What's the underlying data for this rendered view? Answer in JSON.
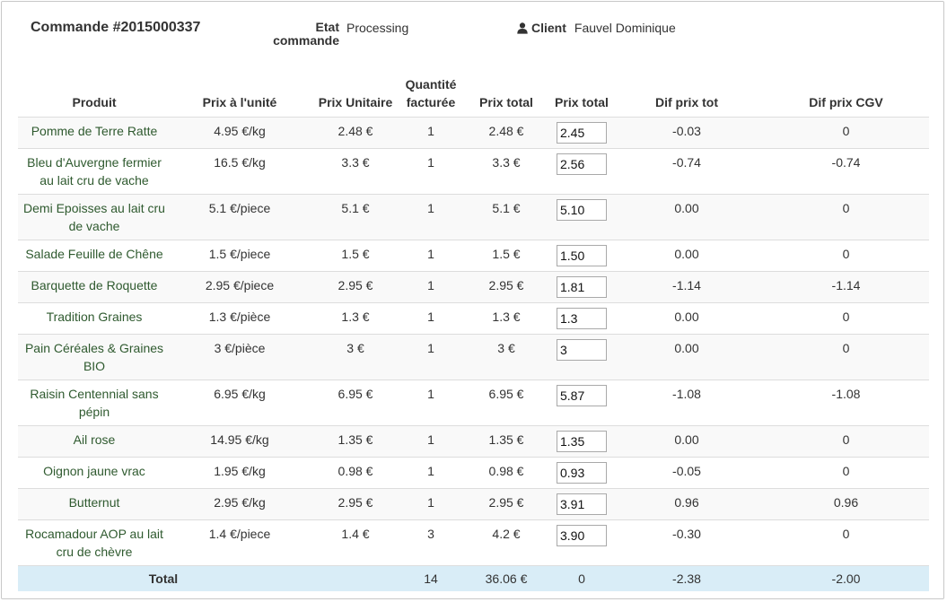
{
  "header": {
    "order_title": "Commande #2015000337",
    "status_label": "Etat commande",
    "status_value": "Processing",
    "client_label": "Client",
    "client_value": "Fauvel Dominique",
    "client_icon": "user-icon"
  },
  "table": {
    "columns": [
      "Produit",
      "Prix à l'unité",
      "Prix Unitaire",
      "Quantité facturée",
      "Prix total",
      "Prix total",
      "Dif prix tot",
      "Dif prix CGV"
    ],
    "rows": [
      {
        "product": "Pomme de Terre Ratte",
        "unit_price": "4.95 €/kg",
        "prix_unitaire": "2.48 €",
        "quantity": "1",
        "prix_total": "2.48 €",
        "input_value": "2.45",
        "dif_tot": "-0.03",
        "dif_cgv": "0"
      },
      {
        "product": "Bleu d'Auvergne fermier au lait cru de vache",
        "unit_price": "16.5 €/kg",
        "prix_unitaire": "3.3 €",
        "quantity": "1",
        "prix_total": "3.3 €",
        "input_value": "2.56",
        "dif_tot": "-0.74",
        "dif_cgv": "-0.74"
      },
      {
        "product": "Demi Epoisses au lait cru de vache",
        "unit_price": "5.1 €/piece",
        "prix_unitaire": "5.1 €",
        "quantity": "1",
        "prix_total": "5.1 €",
        "input_value": "5.10",
        "dif_tot": "0.00",
        "dif_cgv": "0"
      },
      {
        "product": "Salade Feuille de Chêne",
        "unit_price": "1.5 €/piece",
        "prix_unitaire": "1.5 €",
        "quantity": "1",
        "prix_total": "1.5 €",
        "input_value": "1.50",
        "dif_tot": "0.00",
        "dif_cgv": "0"
      },
      {
        "product": "Barquette de Roquette",
        "unit_price": "2.95 €/piece",
        "prix_unitaire": "2.95 €",
        "quantity": "1",
        "prix_total": "2.95 €",
        "input_value": "1.81",
        "dif_tot": "-1.14",
        "dif_cgv": "-1.14"
      },
      {
        "product": "Tradition Graines",
        "unit_price": "1.3 €/pièce",
        "prix_unitaire": "1.3 €",
        "quantity": "1",
        "prix_total": "1.3 €",
        "input_value": "1.3",
        "dif_tot": "0.00",
        "dif_cgv": "0"
      },
      {
        "product": "Pain Céréales & Graines BIO",
        "unit_price": "3 €/pièce",
        "prix_unitaire": "3 €",
        "quantity": "1",
        "prix_total": "3 €",
        "input_value": "3",
        "dif_tot": "0.00",
        "dif_cgv": "0"
      },
      {
        "product": "Raisin Centennial sans pépin",
        "unit_price": "6.95 €/kg",
        "prix_unitaire": "6.95 €",
        "quantity": "1",
        "prix_total": "6.95 €",
        "input_value": "5.87",
        "dif_tot": "-1.08",
        "dif_cgv": "-1.08"
      },
      {
        "product": "Ail rose",
        "unit_price": "14.95 €/kg",
        "prix_unitaire": "1.35 €",
        "quantity": "1",
        "prix_total": "1.35 €",
        "input_value": "1.35",
        "dif_tot": "0.00",
        "dif_cgv": "0"
      },
      {
        "product": "Oignon jaune vrac",
        "unit_price": "1.95 €/kg",
        "prix_unitaire": "0.98 €",
        "quantity": "1",
        "prix_total": "0.98 €",
        "input_value": "0.93",
        "dif_tot": "-0.05",
        "dif_cgv": "0"
      },
      {
        "product": "Butternut",
        "unit_price": "2.95 €/kg",
        "prix_unitaire": "2.95 €",
        "quantity": "1",
        "prix_total": "2.95 €",
        "input_value": "3.91",
        "dif_tot": "0.96",
        "dif_cgv": "0.96"
      },
      {
        "product": "Rocamadour AOP au lait cru de chèvre",
        "unit_price": "1.4 €/piece",
        "prix_unitaire": "1.4 €",
        "quantity": "3",
        "prix_total": "4.2 €",
        "input_value": "3.90",
        "dif_tot": "-0.30",
        "dif_cgv": "0"
      }
    ],
    "footer": {
      "label": "Total",
      "quantity": "14",
      "prix_total": "36.06 €",
      "input_total": "0",
      "dif_tot": "-2.38",
      "dif_cgv": "-2.00"
    }
  },
  "colors": {
    "product_text": "#2f5a2f",
    "total_row_bg": "#d9edf7",
    "stripe_bg": "#f9f9f9"
  }
}
